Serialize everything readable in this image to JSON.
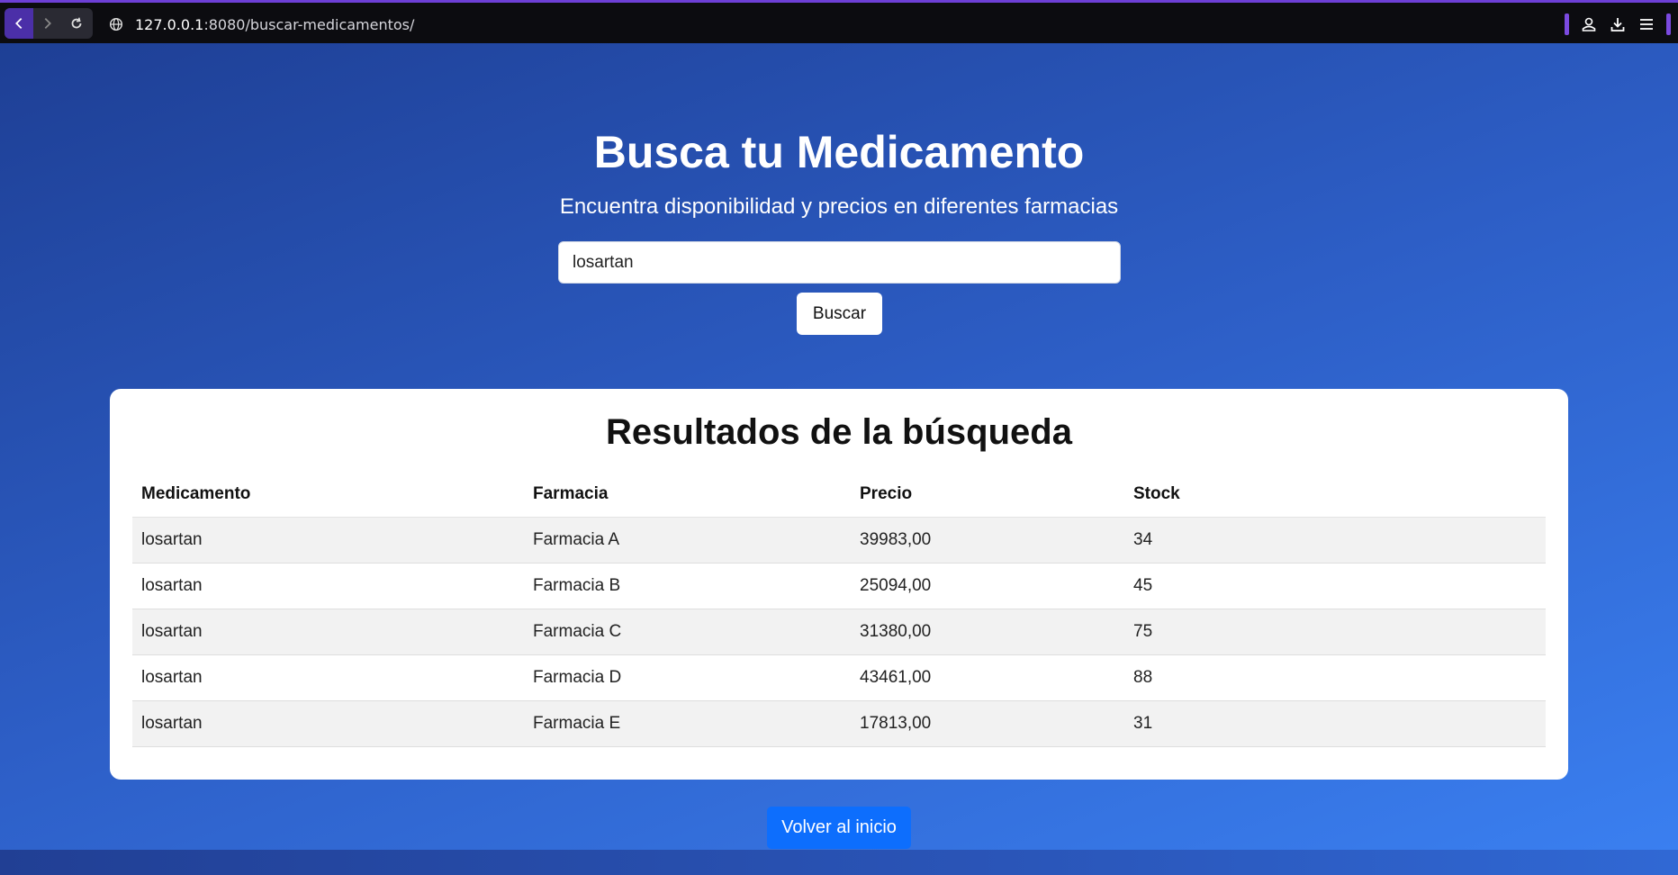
{
  "browser": {
    "url_host": "127.0.0.1",
    "url_rest": ":8080/buscar-medicamentos/",
    "icons": [
      "back-icon",
      "forward-icon",
      "reload-icon",
      "globe-icon",
      "account-icon",
      "download-icon",
      "menu-icon"
    ]
  },
  "header": {
    "title": "Busca tu Medicamento",
    "subtitle": "Encuentra disponibilidad y precios en diferentes farmacias"
  },
  "search": {
    "value": "losartan",
    "button_label": "Buscar"
  },
  "results": {
    "title": "Resultados de la búsqueda",
    "columns": [
      "Medicamento",
      "Farmacia",
      "Precio",
      "Stock"
    ],
    "rows": [
      [
        "losartan",
        "Farmacia A",
        "39983,00",
        "34"
      ],
      [
        "losartan",
        "Farmacia B",
        "25094,00",
        "45"
      ],
      [
        "losartan",
        "Farmacia C",
        "31380,00",
        "75"
      ],
      [
        "losartan",
        "Farmacia D",
        "43461,00",
        "88"
      ],
      [
        "losartan",
        "Farmacia E",
        "17813,00",
        "31"
      ]
    ]
  },
  "footer": {
    "back_label": "Volver al inicio"
  },
  "colors": {
    "accent_blue": "#0d6efd",
    "browser_accent": "#6d3fd6"
  }
}
